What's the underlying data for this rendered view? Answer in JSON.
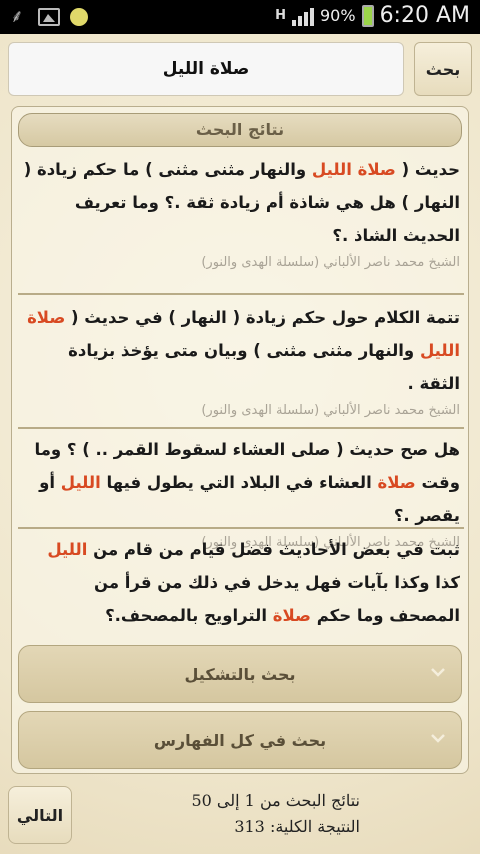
{
  "status_bar": {
    "battery_percent": "90%",
    "time": "6:20 AM",
    "network_label": "H",
    "icons": [
      "usb-icon",
      "image-icon",
      "notification-dot-icon",
      "hspa-icon",
      "signal-icon",
      "battery-charging-icon"
    ]
  },
  "search": {
    "query": "صلاة الليل",
    "button_label": "بحث"
  },
  "results": {
    "header": "نتائج البحث",
    "items": [
      {
        "parts": [
          "حديث ( ",
          "صلاة الليل",
          " والنهار مثنى مثنى ) ما حكم زيادة ( النهار ) هل هي شاذة أم زيادة ثقة .؟ وما تعريف الحديث الشاذ .؟"
        ],
        "source": "الشيخ محمد ناصر الألباني (سلسلة الهدى والنور)"
      },
      {
        "parts": [
          "تتمة الكلام حول حكم زيادة ( النهار ) في حديث ( ",
          "صلاة الليل",
          " والنهار مثنى مثنى ) وبيان متى يؤخذ بزيادة الثقة ."
        ],
        "source": "الشيخ محمد ناصر الألباني (سلسلة الهدى والنور)"
      },
      {
        "parts": [
          "هل صح حديث ( صلى العشاء لسقوط القمر .. ) ؟ وما وقت ",
          "صلاة",
          " العشاء في البلاد التي يطول فيها ",
          "الليل",
          " أو يقصر .؟"
        ],
        "source": "الشيخ محمد ناصر الألباني (سلسلة الهدى والنور)"
      },
      {
        "parts": [
          "ثبت في بعض الأحاديث فضل قيام من قام من ",
          "الليل",
          " كذا وكذا بآيات فهل يدخل في ذلك من قرأ من المصحف وما حكم ",
          "صلاة",
          " التراويح بالمصحف.؟"
        ],
        "source": ""
      }
    ]
  },
  "accordions": {
    "diacritics_label": "بحث بالتشكيل",
    "all_indexes_label": "بحث في كل الفهارس"
  },
  "footer": {
    "range_text": "نتائج البحث من 1 إلى 50",
    "total_text": "النتيجة الكلية: 313",
    "next_label": "التالي"
  },
  "colors": {
    "highlight": "#d84a22",
    "background": "#f3ecd8"
  }
}
